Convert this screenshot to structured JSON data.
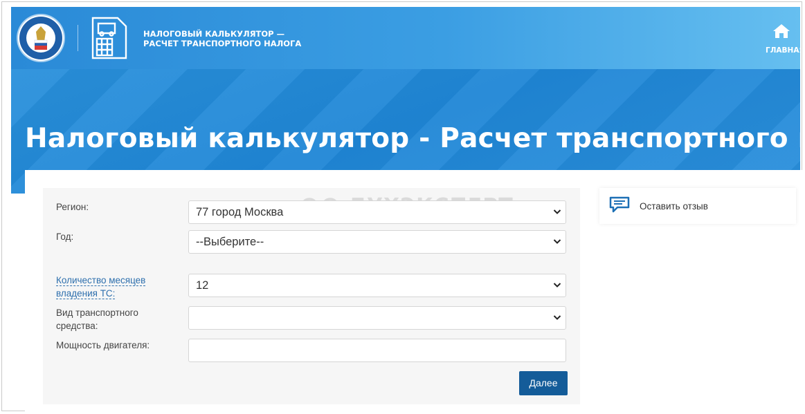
{
  "header": {
    "title_line1": "НАЛОГОВЫЙ КАЛЬКУЛЯТОР —",
    "title_line2": "РАСЧЕТ ТРАНСПОРТНОГО НАЛОГА",
    "home_label": "ГЛАВНАЯ",
    "emblem_text": "ФЕДЕРАЛЬНАЯ НАЛОГОВАЯ СЛУЖБА"
  },
  "hero": {
    "title": "Налоговый калькулятор - Расчет транспортного налога"
  },
  "form": {
    "region_label": "Регион:",
    "region_value": "77 город Москва",
    "year_label": "Год:",
    "year_value": "--Выберите--",
    "months_label_1": "Количество месяцев",
    "months_label_2": "владения ТС:",
    "months_value": "12",
    "vehicle_label_1": "Вид транспортного",
    "vehicle_label_2": "средства:",
    "vehicle_value": "",
    "power_label": "Мощность двигателя:",
    "power_value": "",
    "next_button": "Далее"
  },
  "sidebar": {
    "feedback_label": "Оставить отзыв"
  },
  "watermark": {
    "text": "БУХЭКСПЕРТ"
  },
  "colors": {
    "header_blue": "#2a8ad7",
    "button_blue": "#145c99",
    "link_blue": "#2d6fad"
  },
  "icons": [
    "fns-emblem-icon",
    "calculator-car-icon",
    "home-icon",
    "chevron-down-icon",
    "feedback-chat-icon",
    "watermark-glasses-icon"
  ]
}
